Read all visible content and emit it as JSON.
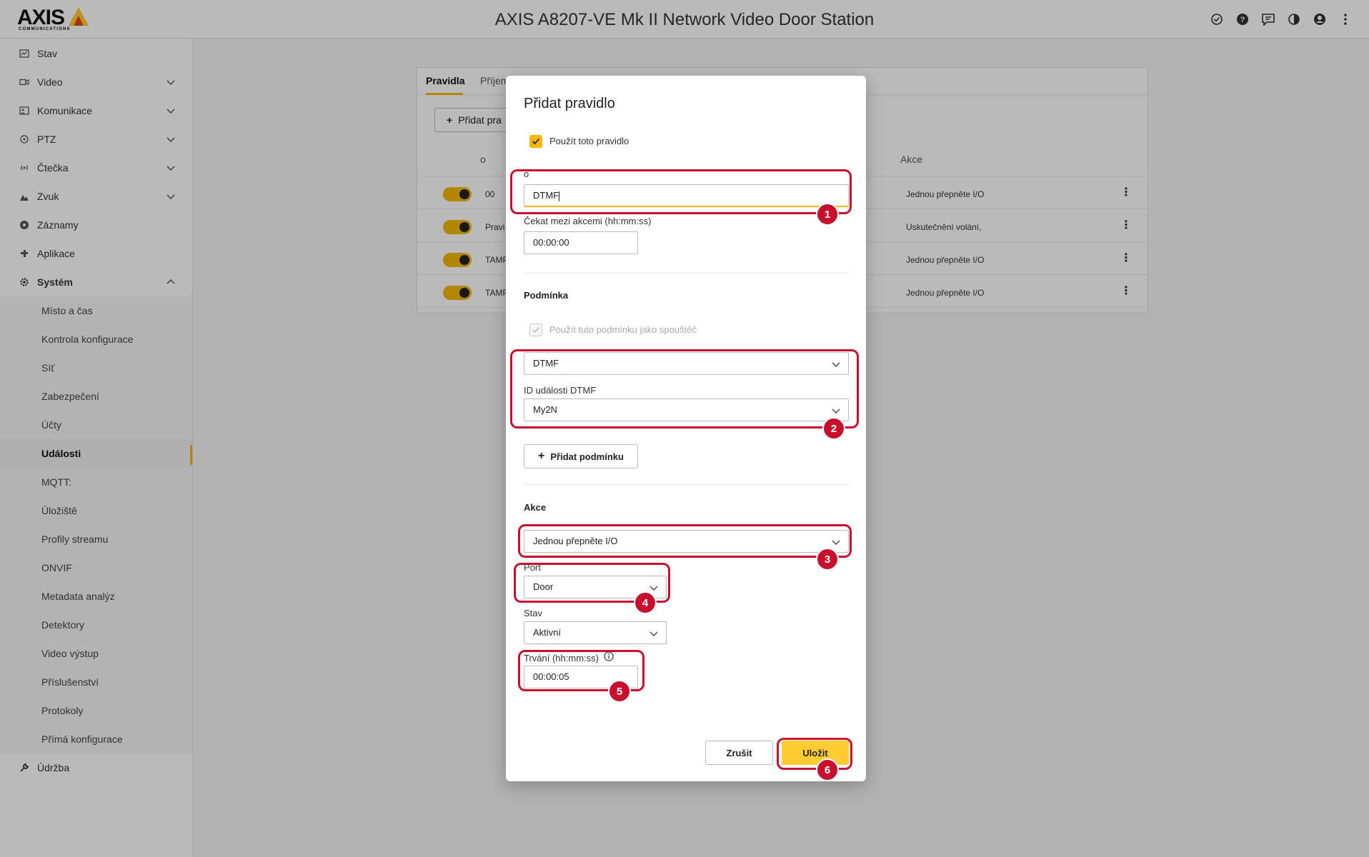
{
  "app": {
    "title": "AXIS A8207-VE Mk II Network Video Door Station",
    "logo_text": "AXIS",
    "logo_sub": "COMMUNICATIONS"
  },
  "sidebar": {
    "items": [
      {
        "label": "Stav",
        "icon": "status-icon"
      },
      {
        "label": "Video",
        "icon": "video-icon",
        "expandable": true
      },
      {
        "label": "Komunikace",
        "icon": "communication-icon",
        "expandable": true
      },
      {
        "label": "PTZ",
        "icon": "ptz-icon",
        "expandable": true
      },
      {
        "label": "Čtečka",
        "icon": "reader-icon",
        "expandable": true
      },
      {
        "label": "Zvuk",
        "icon": "audio-icon",
        "expandable": true
      },
      {
        "label": "Záznamy",
        "icon": "recordings-icon"
      },
      {
        "label": "Aplikace",
        "icon": "apps-icon"
      },
      {
        "label": "Systém",
        "icon": "gear-icon",
        "expanded": true
      }
    ],
    "system_sub": [
      "Místo a čas",
      "Kontrola konfigurace",
      "Síť",
      "Zabezpečení",
      "Účty",
      "Události",
      "MQTT:",
      "Úložiště",
      "Profily streamu",
      "ONVIF",
      "Metadata analýz",
      "Detektory",
      "Video výstup",
      "Příslušenství",
      "Protokoly",
      "Přímá konfigurace"
    ],
    "active_sub": "Události",
    "maintenance": {
      "label": "Údržba",
      "icon": "wrench-icon"
    }
  },
  "background_card": {
    "tabs": [
      "Pravidla",
      "Příjem"
    ],
    "add_button": "Přidat pra",
    "col_name": "o",
    "col_action": "Akce",
    "rows": [
      {
        "name": "00",
        "action": "Jednou přepněte I/O"
      },
      {
        "name": "Pravi",
        "action": "Uskutečnění volání,"
      },
      {
        "name": "TAMP",
        "action": "Jednou přepněte I/O"
      },
      {
        "name": "TAMP",
        "action": "Jednou přepněte I/O"
      }
    ]
  },
  "dialog": {
    "title": "Přidat pravidlo",
    "use_rule_label": "Použít toto pravidlo",
    "name_label": "o",
    "name_value": "DTMF",
    "wait_label": "Čekat mezi akcemi (hh:mm:ss)",
    "wait_value": "00:00:00",
    "condition_heading": "Podmínka",
    "trigger_label": "Použít tuto podmínku jako spouštěč",
    "condition_value": "DTMF",
    "dtmf_id_label": "ID události DTMF",
    "dtmf_id_value": "My2N",
    "add_condition": "Přidat podmínku",
    "action_heading": "Akce",
    "action_value": "Jednou přepněte I/O",
    "port_label": "Port",
    "port_value": "Door",
    "state_label": "Stav",
    "state_value": "Aktivní",
    "duration_label": "Trvání (hh:mm:ss)",
    "duration_value": "00:00:05",
    "cancel": "Zrušit",
    "save": "Uložit"
  },
  "annotations": [
    "1",
    "2",
    "3",
    "4",
    "5",
    "6"
  ],
  "colors": {
    "accent": "#f5b800",
    "highlight": "#c8102e",
    "primary_button": "#ffcc33"
  }
}
